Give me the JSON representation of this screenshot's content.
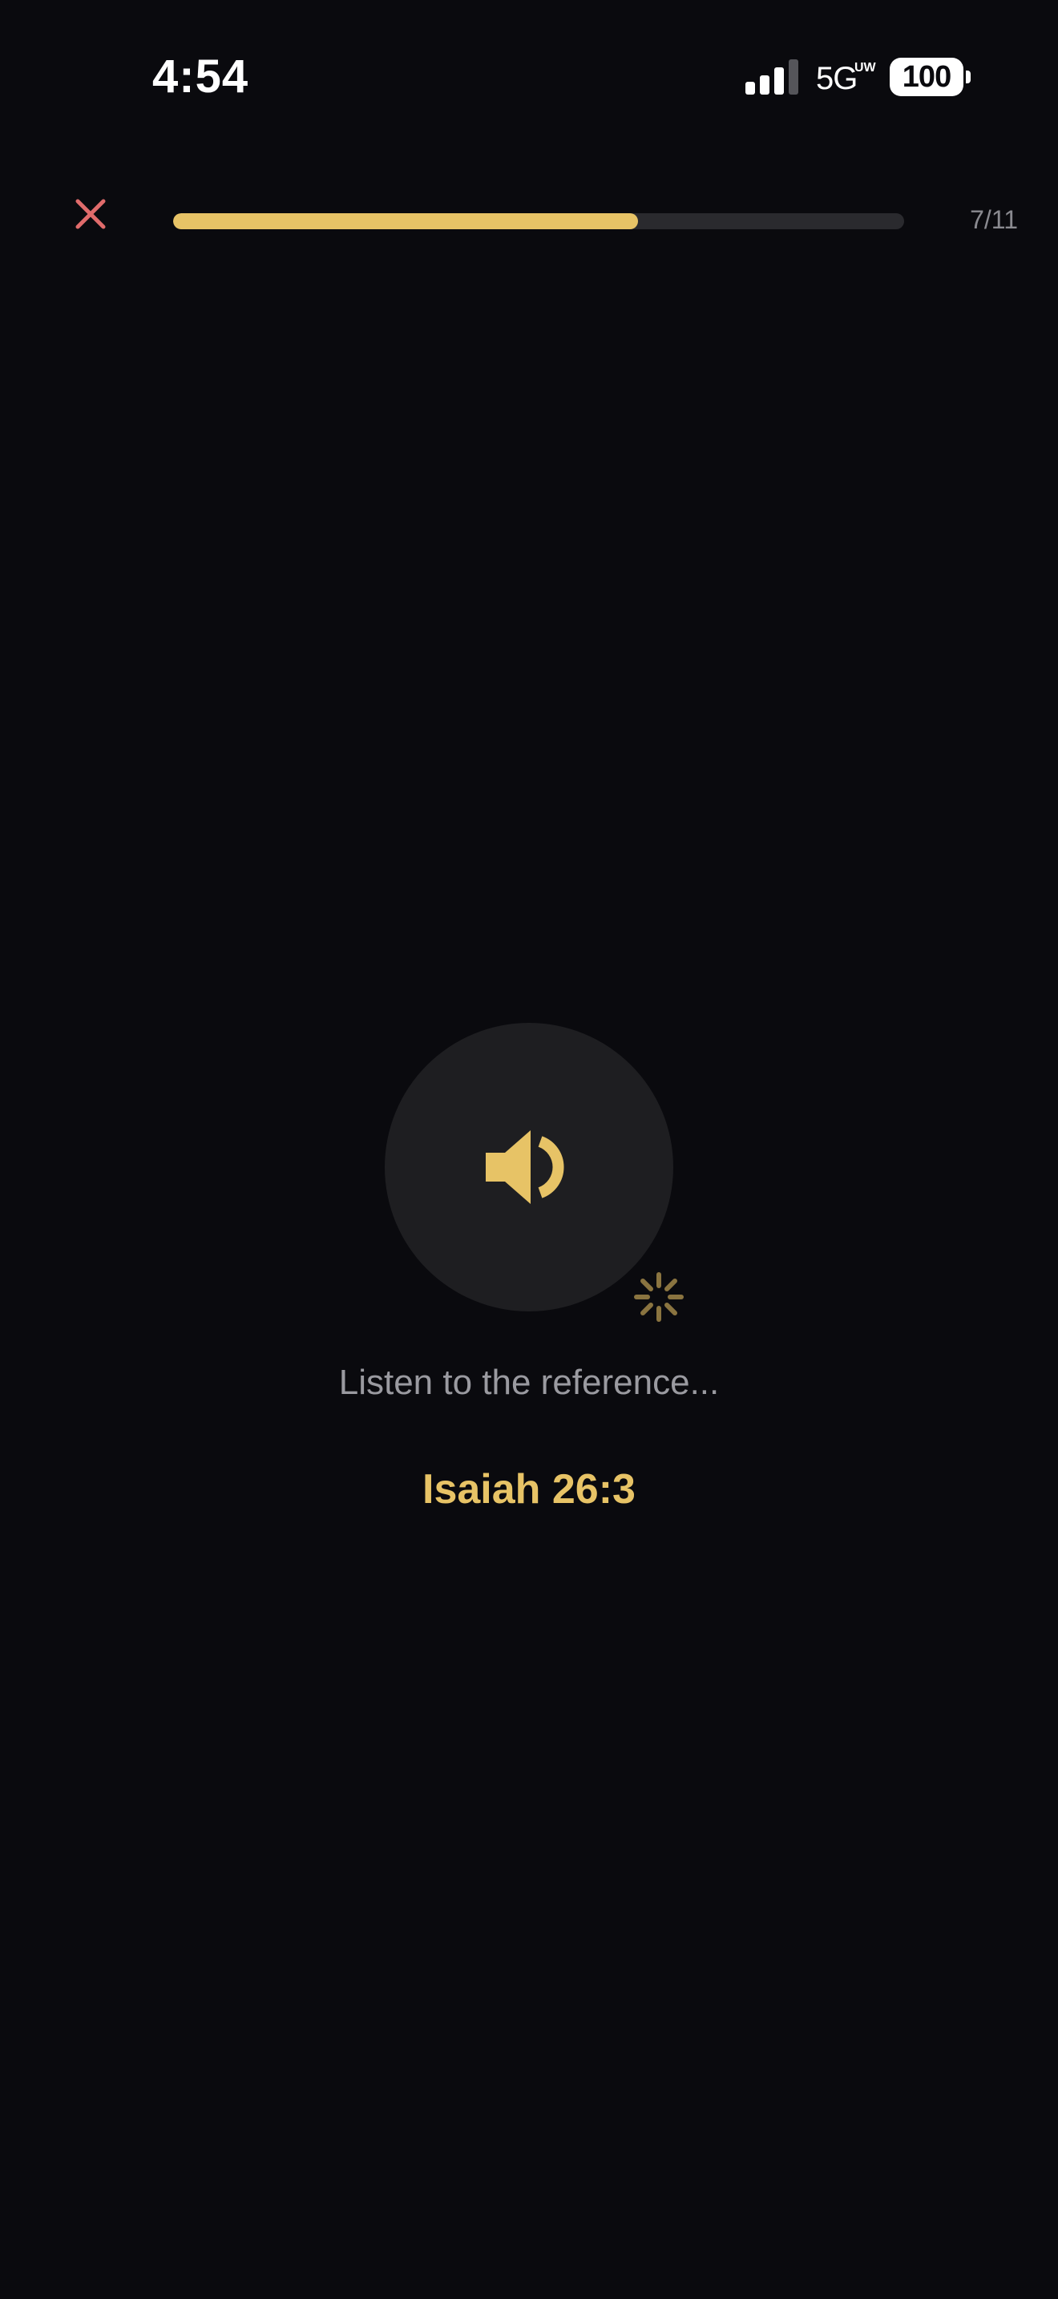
{
  "status_bar": {
    "time": "4:54",
    "network": "5G",
    "network_suffix": "UW",
    "battery": "100",
    "icons": [
      "signal-icon",
      "battery-icon"
    ]
  },
  "header": {
    "close_icon": "close-icon",
    "progress": {
      "current": 7,
      "total": 11,
      "label": "7/11",
      "fraction": 0.636
    }
  },
  "main": {
    "speaker_icon": "speaker-icon",
    "spinner_icon": "loading-spinner-icon",
    "prompt": "Listen to the reference...",
    "reference": "Isaiah 26:3"
  },
  "colors": {
    "accent": "#e7c366",
    "close": "#e06b6b",
    "background": "#0a0a0e",
    "circle": "#1e1e21",
    "track": "#2a2a2e"
  }
}
